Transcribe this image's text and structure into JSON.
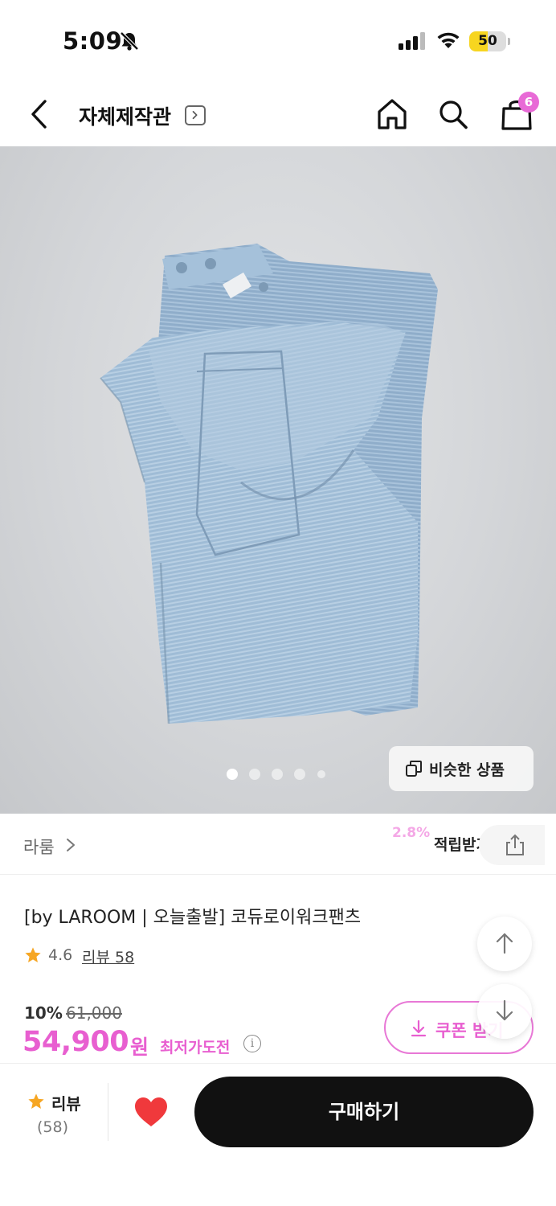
{
  "status_bar": {
    "time": "5:09",
    "battery": "50",
    "battery_level": 0.5,
    "icons": [
      "bell-slash-icon",
      "signal-icon",
      "wifi-icon",
      "battery-icon"
    ]
  },
  "header": {
    "title": "자체제작관",
    "cart_count": "6",
    "icons": [
      "back-icon",
      "chevron-right-icon",
      "home-icon",
      "search-icon",
      "cart-icon"
    ]
  },
  "gallery": {
    "total_images": 5,
    "active_index": 0,
    "similar_label": "비슷한 상품"
  },
  "brand": {
    "name": "라룸",
    "reward_percent": "2.8%",
    "reward_label": "적립받기"
  },
  "product": {
    "name": "[by LAROOM | 오늘출발] 코듀로이워크팬츠",
    "rating": "4.6",
    "review_link": "리뷰 58",
    "discount": "10%",
    "original_price": "61,000",
    "price": "54,900",
    "price_unit": "원",
    "lowest_label": "최저가도전",
    "coupon_label": "쿠폰 받기"
  },
  "bottom_bar": {
    "review_label": "리뷰",
    "review_count": "(58)",
    "buy_label": "구매하기"
  },
  "colors": {
    "accent": "#e85fd0",
    "star": "#f6a623",
    "heart": "#f0393c",
    "buy_button": "#111111",
    "battery": "#f7d520"
  }
}
